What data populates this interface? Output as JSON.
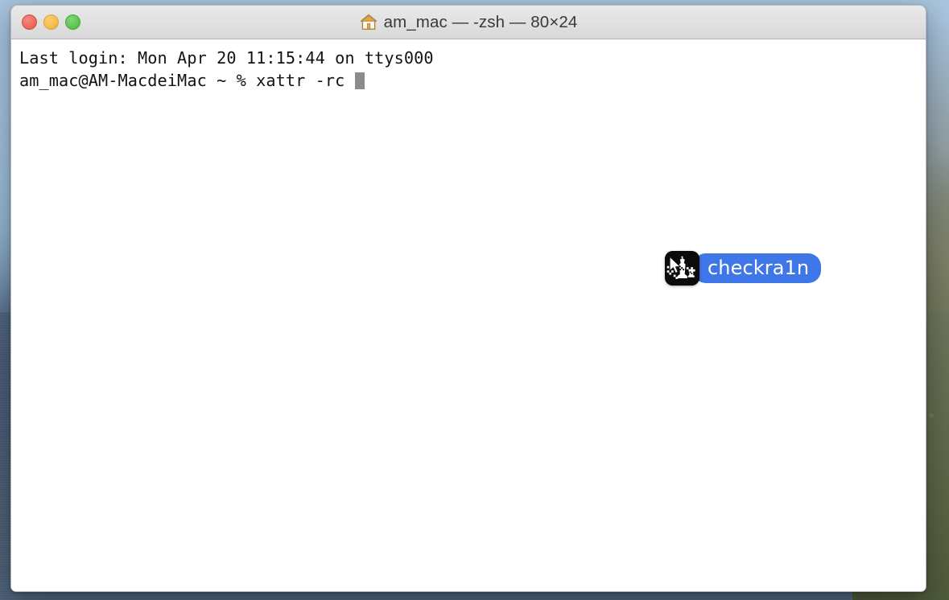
{
  "desktop": {
    "name": "macos-desktop-wallpaper",
    "description": "mountain and water wallpaper"
  },
  "window": {
    "title": "am_mac — -zsh — 80×24",
    "home_icon": "home-icon",
    "traffic_lights": [
      {
        "name": "close-button",
        "label": "Close",
        "color": "#ec6a5e"
      },
      {
        "name": "minimize-button",
        "label": "Minimize",
        "color": "#f5bd4f"
      },
      {
        "name": "zoom-button",
        "label": "Zoom",
        "color": "#61c554"
      }
    ]
  },
  "terminal": {
    "lines": [
      "Last login: Mon Apr 20 11:15:44 on ttys000",
      "am_mac@AM-MacdeiMac ~ % xattr -rc "
    ],
    "login_line": "Last login: Mon Apr 20 11:15:44 on ttys000",
    "prompt": "am_mac@AM-MacdeiMac ~ % ",
    "command": "xattr -rc ",
    "cursor": "block-cursor",
    "text_color": "#131313",
    "background_color": "#ffffff"
  },
  "drag": {
    "app_name": "checkra1n",
    "icon_name": "checkra1n-app-icon",
    "label_background": "#3f76e8",
    "label_text_color": "#ffffff",
    "cursor": "drag-copy-cursor"
  }
}
